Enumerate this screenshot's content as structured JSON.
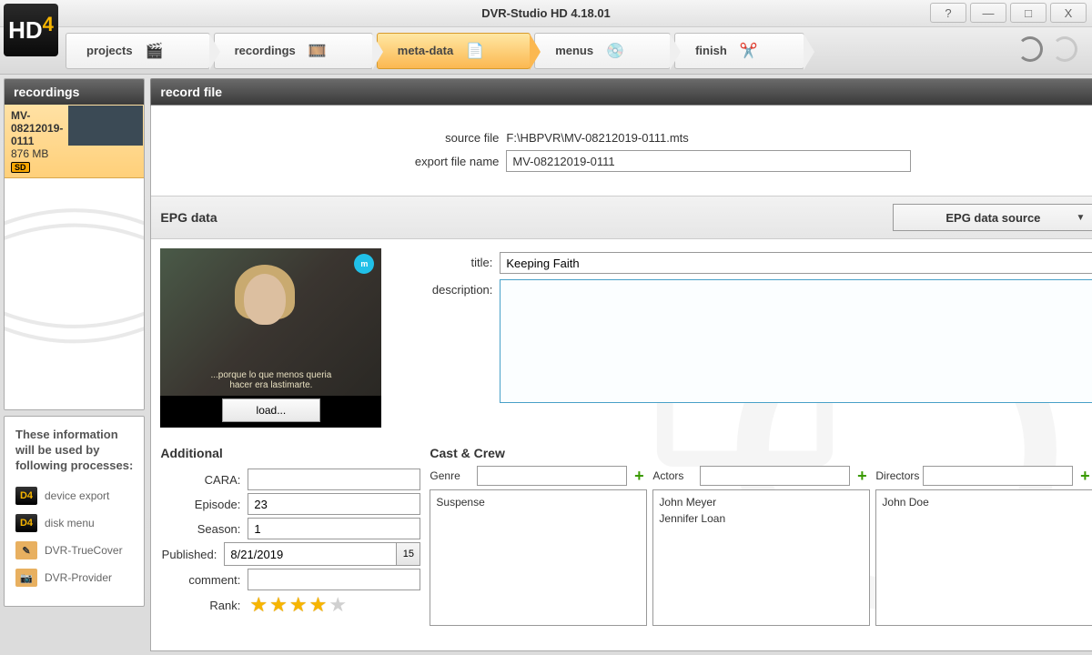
{
  "app": {
    "title": "DVR-Studio HD 4.18.01"
  },
  "winbtns": {
    "help": "?",
    "min": "—",
    "max": "□",
    "close": "X"
  },
  "logo": {
    "h": "H",
    "d": "D",
    "four": "4"
  },
  "steps": {
    "projects": "projects",
    "recordings": "recordings",
    "metadata": "meta-data",
    "menus": "menus",
    "finish": "finish"
  },
  "left": {
    "recordings_title": "recordings",
    "item": {
      "name": "MV-08212019-0111",
      "size": "876 MB",
      "sd": "SD"
    },
    "info_title": "These information will be used by following processes:",
    "proc": {
      "device_export": "device export",
      "disk_menu": "disk menu",
      "truecover": "DVR-TrueCover",
      "provider": "DVR-Provider"
    }
  },
  "right": {
    "title": "record file",
    "source_label": "source file",
    "source_value": "F:\\HBPVR\\MV-08212019-0111.mts",
    "export_label": "export file name",
    "export_value": "MV-08212019-0111"
  },
  "epg": {
    "section_title": "EPG data",
    "source_btn": "EPG data source",
    "title_label": "title:",
    "title_value": "Keeping Faith",
    "desc_label": "description:",
    "desc_value": "",
    "preview_sub": "...porque lo que menos queria\nhacer era lastimarte.",
    "load_btn": "load...",
    "badge": "m"
  },
  "additional": {
    "heading": "Additional",
    "cara_label": "CARA:",
    "cara": "",
    "episode_label": "Episode:",
    "episode": "23",
    "season_label": "Season:",
    "season": "1",
    "published_label": "Published:",
    "published": "8/21/2019",
    "cal_day": "15",
    "comment_label": "comment:",
    "comment": "",
    "rank_label": "Rank:",
    "rank": 4
  },
  "cast": {
    "heading": "Cast & Crew",
    "genre_label": "Genre",
    "actors_label": "Actors",
    "directors_label": "Directors",
    "genre_input": "",
    "actors_input": "",
    "directors_input": "",
    "genres": [
      "Suspense"
    ],
    "actors": [
      "John Meyer",
      "Jennifer Loan"
    ],
    "directors": [
      "John Doe"
    ]
  }
}
